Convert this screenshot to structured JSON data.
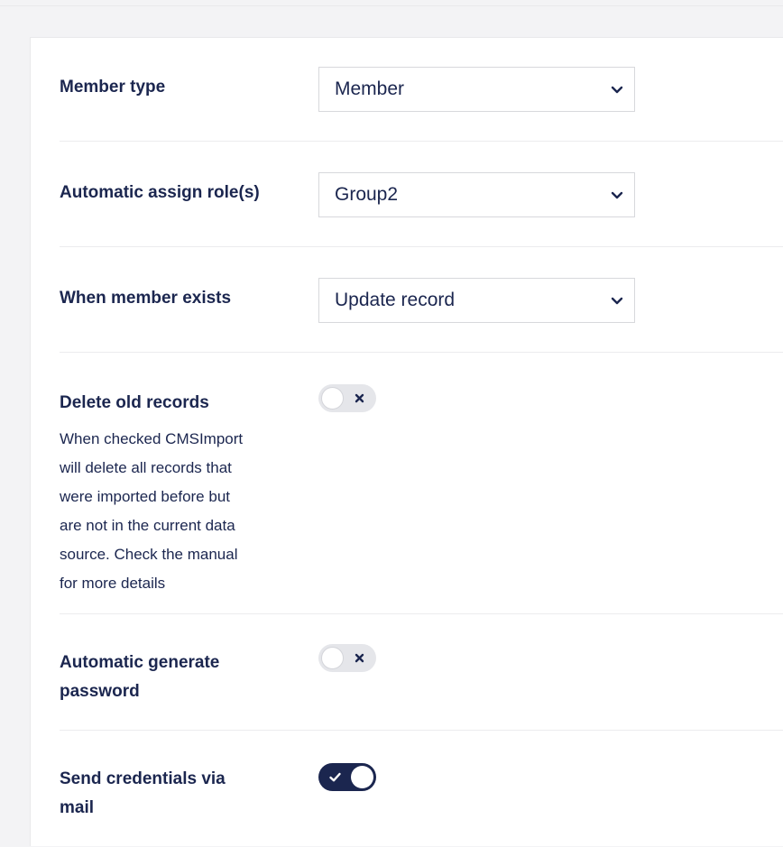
{
  "form": {
    "member_type": {
      "label": "Member type",
      "value": "Member"
    },
    "auto_assign_roles": {
      "label": "Automatic assign role(s)",
      "value": "Group2"
    },
    "when_member_exists": {
      "label": "When member exists",
      "value": "Update record"
    },
    "delete_old_records": {
      "label": "Delete old records",
      "description": [
        "When checked CMSImport",
        "will delete all records that",
        "were imported before but",
        "are not in the current data",
        "source. Check the manual",
        "for more details"
      ],
      "checked": false
    },
    "auto_generate_password": {
      "label_lines": [
        "Automatic generate",
        "password"
      ],
      "checked": false
    },
    "send_credentials": {
      "label_lines": [
        "Send credentials via",
        "mail"
      ],
      "checked": true
    }
  },
  "colors": {
    "text": "#1b264f",
    "toggle_on": "#1b264f",
    "toggle_off": "#e5e6ea",
    "border": "#d7d8dc"
  },
  "icons": {
    "select_arrow": "chevron-down-icon",
    "toggle_off": "close-icon",
    "toggle_on": "check-icon"
  }
}
